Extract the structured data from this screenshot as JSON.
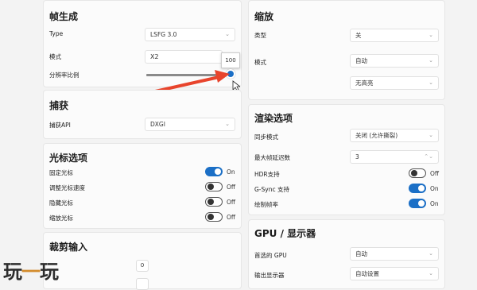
{
  "frame_gen": {
    "title": "帧生成",
    "type_label": "Type",
    "type_value": "LSFG 3.0",
    "mode_label": "模式",
    "mode_value": "X2",
    "ratio_label": "分辨率比例",
    "slider_tooltip": "100",
    "slider_value_percent": 100
  },
  "capture": {
    "title": "捕获",
    "api_label": "捕获API",
    "api_value": "DXGI"
  },
  "cursor": {
    "title": "光标选项",
    "items": [
      {
        "label": "固定光标",
        "state": "On",
        "on": true
      },
      {
        "label": "调整光标速度",
        "state": "Off",
        "on": false
      },
      {
        "label": "隐藏光标",
        "state": "Off",
        "on": false
      },
      {
        "label": "缩放光标",
        "state": "Off",
        "on": false
      }
    ]
  },
  "crop": {
    "title": "裁剪输入",
    "value": "0"
  },
  "scaling": {
    "title": "缩放",
    "type_label": "类型",
    "type_value": "关",
    "mode_label": "模式",
    "mode_value": "自动",
    "extra_value": "无高亮"
  },
  "render": {
    "title": "渲染选项",
    "sync_label": "同步模式",
    "sync_value": "关闭 (允许撕裂)",
    "maxframes_label": "最大帧延迟数",
    "maxframes_value": "3",
    "toggles": [
      {
        "label": "HDR支持",
        "state": "Off",
        "on": false
      },
      {
        "label": "G-Sync 支持",
        "state": "On",
        "on": true
      },
      {
        "label": "绘制帧率",
        "state": "On",
        "on": true
      }
    ]
  },
  "gpu": {
    "title": "GPU / 显示器",
    "gpu_label": "首选的 GPU",
    "gpu_value": "自动",
    "output_label": "输出显示器",
    "output_value": "自动设置"
  },
  "watermark": {
    "left": "玩",
    "dash": "一",
    "right": "玩"
  },
  "colors": {
    "accent": "#1b6fc6",
    "arrow": "#e8442c"
  }
}
